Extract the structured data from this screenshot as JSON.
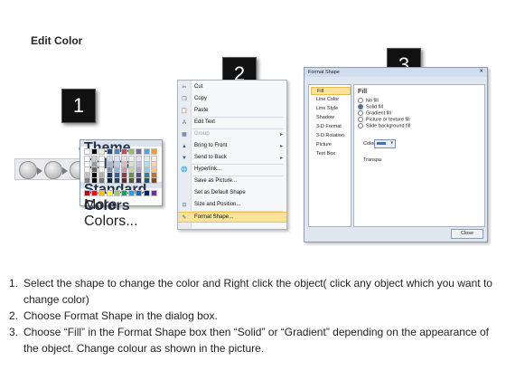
{
  "title": "Edit Color",
  "badges": [
    "1",
    "2",
    "3"
  ],
  "context_menu": {
    "items": [
      {
        "icon": "scissors-icon",
        "glyph": "✂",
        "label": "Cut",
        "enabled": true
      },
      {
        "icon": "copy-icon",
        "glyph": "❐",
        "label": "Copy",
        "enabled": true
      },
      {
        "icon": "paste-icon",
        "glyph": "📋",
        "label": "Paste",
        "enabled": true
      },
      {
        "icon": "edit-text-icon",
        "glyph": "A",
        "label": "Edit Text",
        "enabled": true
      },
      {
        "icon": "group-icon",
        "glyph": "▦",
        "label": "Group",
        "enabled": false,
        "submenu": true
      },
      {
        "icon": "bring-to-front-icon",
        "glyph": "▲",
        "label": "Bring to Front",
        "enabled": true,
        "submenu": true
      },
      {
        "icon": "send-to-back-icon",
        "glyph": "▼",
        "label": "Send to Back",
        "enabled": true,
        "submenu": true
      },
      {
        "icon": "hyperlink-icon",
        "glyph": "🌐",
        "label": "Hyperlink...",
        "enabled": true
      },
      {
        "icon": "",
        "glyph": "",
        "label": "Save as Picture...",
        "enabled": true
      },
      {
        "icon": "",
        "glyph": "",
        "label": "Set as Default Shape",
        "enabled": true
      },
      {
        "icon": "size-position-icon",
        "glyph": "⊡",
        "label": "Size and Position...",
        "enabled": true
      },
      {
        "icon": "format-shape-icon",
        "glyph": "✎",
        "label": "Format Shape...",
        "enabled": true,
        "highlighted": true
      }
    ]
  },
  "dialog": {
    "title": "Format Shape",
    "close_glyph": "✕",
    "categories": [
      "Fill",
      "Line Color",
      "Line Style",
      "Shadow",
      "3-D Format",
      "3-D Rotation",
      "Picture",
      "Text Box"
    ],
    "pane_heading": "Fill",
    "options": [
      "No fill",
      "Solid fill",
      "Gradient fill",
      "Picture or texture fill",
      "Slide background fill"
    ],
    "selected_option": "Solid fill",
    "color_label": "Color:",
    "transparency_label": "Transpa",
    "palette": {
      "theme_heading": "Theme Colors",
      "standard_heading": "Standard Colors",
      "more": "More Colors...",
      "theme_top": [
        "#ffffff",
        "#000000",
        "#eeece1",
        "#1f497d",
        "#4f81bd",
        "#c0504d",
        "#9bbb59",
        "#8064a2",
        "#4bacc6",
        "#f79646"
      ],
      "standard": [
        "#c00000",
        "#ff0000",
        "#ffc000",
        "#ffff00",
        "#92d050",
        "#00b050",
        "#00b0f0",
        "#0070c0",
        "#002060",
        "#7030a0"
      ]
    },
    "close_button": "Close"
  },
  "steps": [
    {
      "n": "1.",
      "text": "Select the shape to change the color and Right click the object( click any object which you want to change color)"
    },
    {
      "n": "2.",
      "text": "Choose Format Shape in the dialog box."
    },
    {
      "n": "3.",
      "text": "Choose “Fill” in the Format Shape box then “Solid” or “Gradient” depending on the appearance of the object. Change colour as shown in the picture."
    }
  ]
}
